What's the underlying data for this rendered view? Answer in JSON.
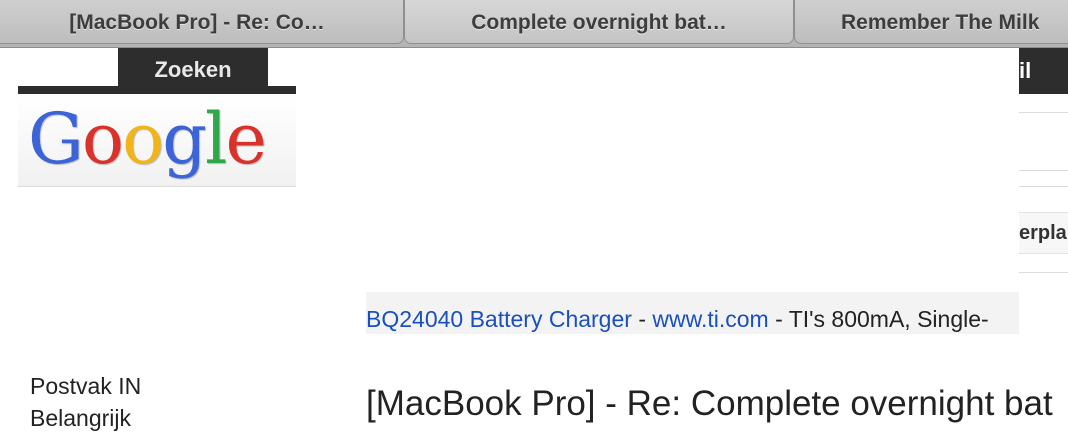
{
  "tabs": [
    {
      "label": "[MacBook Pro] - Re: Co…"
    },
    {
      "label": "Complete overnight bat…"
    },
    {
      "label": "Remember The Milk"
    }
  ],
  "header": {
    "search_label": "Zoeken",
    "right_clipped_label": "il"
  },
  "logo": {
    "letters": [
      "G",
      "o",
      "o",
      "g",
      "l",
      "e"
    ],
    "colors": [
      "#3b64d8",
      "#d8322a",
      "#f0b51b",
      "#3b64d8",
      "#2ea84a",
      "#d8322a"
    ]
  },
  "right_panel": {
    "clipped_text": "erpla"
  },
  "ad": {
    "title": "BQ24040 Battery Charger",
    "sep1": " - ",
    "url": "www.ti.com",
    "text": " - TI's 800mA, Single-"
  },
  "nav": {
    "items": [
      "Postvak IN",
      "Belangrijk"
    ]
  },
  "message": {
    "subject": "[MacBook Pro] - Re: Complete overnight bat"
  },
  "colors": {
    "dark_bar": "#2d2d2d",
    "link": "#1a4fbf",
    "tab_bg": "#c4c4c4"
  }
}
